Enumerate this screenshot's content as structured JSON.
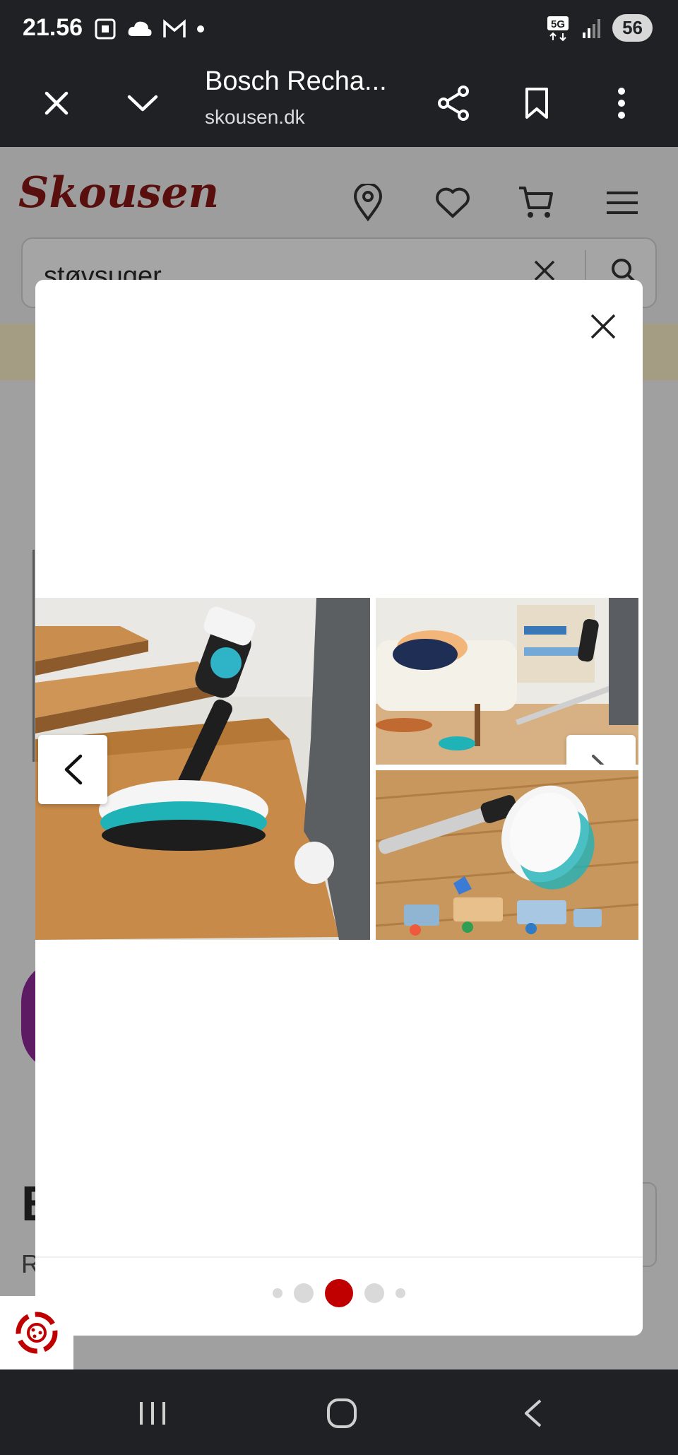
{
  "status_bar": {
    "time": "21.56",
    "network": "5G",
    "battery": "56"
  },
  "browser_tab": {
    "title": "Bosch Recha...",
    "url": "skousen.dk"
  },
  "site": {
    "logo_text": "Skousen",
    "search_value": "støvsuger",
    "peek_title": "B",
    "peek_sub": "R"
  },
  "gallery": {
    "images": [
      {
        "label": "Bosch stick vacuum mopping wooden stairs"
      },
      {
        "label": "Bosch vacuum cleaning under sofa in living room"
      },
      {
        "label": "Bosch wet mop head on wooden floor with toy train"
      }
    ],
    "page_count": 5,
    "active_page_index": 2
  },
  "colors": {
    "accent_red": "#c00000",
    "bar_dark": "#202125",
    "mop_teal": "#1fb3b8"
  }
}
